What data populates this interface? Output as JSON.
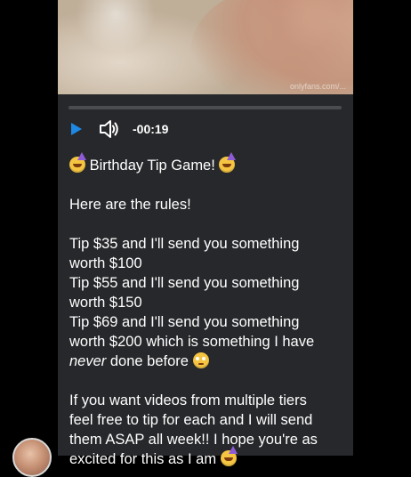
{
  "media": {
    "watermark": "onlyfans.com/..."
  },
  "player": {
    "time": "-00:19",
    "progress": 0
  },
  "post": {
    "title": "Birthday Tip Game!",
    "intro": "Here are the rules!",
    "tier1_line1": "Tip $35 and I'll send you something",
    "tier1_line2": "worth $100",
    "tier2_line1": "Tip $55 and I'll send you something",
    "tier2_line2": "worth $150",
    "tier3_line1": "Tip $69 and I'll send you something",
    "tier3_line2": "worth $200 which is something I have",
    "tier3_emph": "never",
    "tier3_line3_rest": " done before",
    "closing_line1": "If you want videos from multiple tiers",
    "closing_line2": "feel free to tip for each and I will send",
    "closing_line3": "them ASAP all week!! I hope you're as",
    "closing_line4": "excited for this as I am"
  },
  "icons": {
    "play": "play-icon",
    "volume": "volume-icon",
    "emoji_party": "partying-face-emoji",
    "emoji_flushed": "flushed-face-emoji"
  },
  "colors": {
    "accent": "#1e88e5",
    "card_bg": "#27282b",
    "page_bg": "#000000",
    "text": "#ffffff"
  }
}
